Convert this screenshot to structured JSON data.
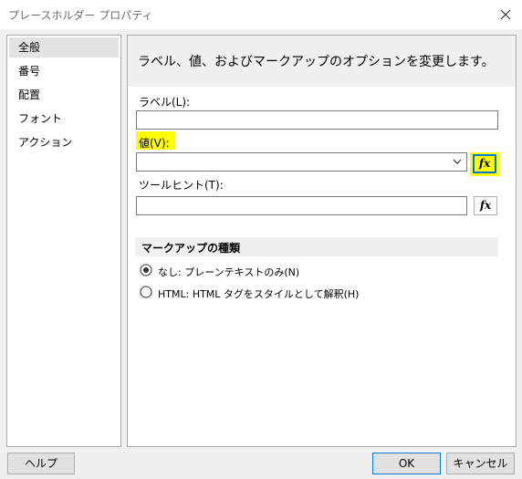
{
  "window": {
    "title": "プレースホルダー プロパティ"
  },
  "nav": {
    "items": [
      {
        "label": "全般",
        "selected": true
      },
      {
        "label": "番号",
        "selected": false
      },
      {
        "label": "配置",
        "selected": false
      },
      {
        "label": "フォント",
        "selected": false
      },
      {
        "label": "アクション",
        "selected": false
      }
    ]
  },
  "panel": {
    "description": "ラベル、値、およびマークアップのオプションを変更します。",
    "label_field": {
      "label": "ラベル(L):",
      "value": ""
    },
    "value_field": {
      "label": "値(V):",
      "value": "",
      "expression_button": "fx"
    },
    "tooltip_field": {
      "label": "ツールヒント(T):",
      "value": "",
      "expression_button": "fx"
    },
    "markup": {
      "heading": "マークアップの種類",
      "options": [
        {
          "label": "なし: プレーンテキストのみ(N)",
          "checked": true
        },
        {
          "label": "HTML: HTML タグをスタイルとして解釈(H)",
          "checked": false
        }
      ]
    }
  },
  "footer": {
    "help": "ヘルプ",
    "ok": "OK",
    "cancel": "キャンセル"
  },
  "colors": {
    "highlight": "#ffff00",
    "focus_border": "#0078d7"
  }
}
